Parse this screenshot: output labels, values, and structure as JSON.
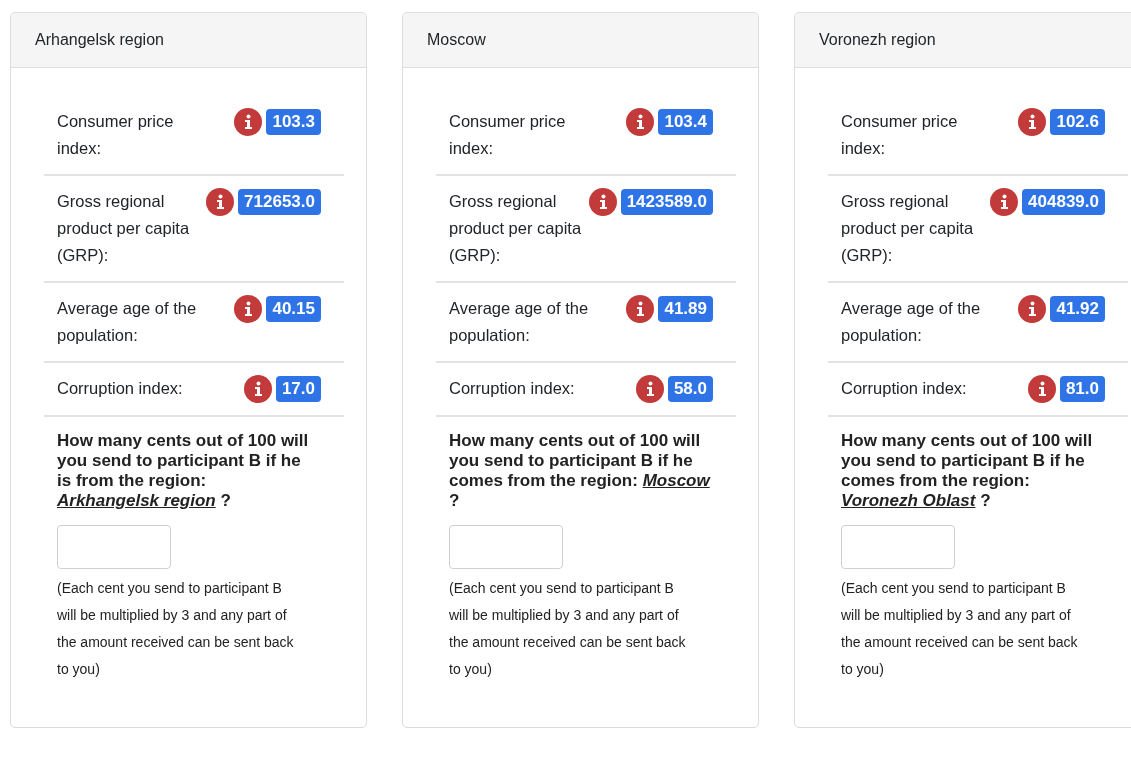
{
  "cards": [
    {
      "title": "Arhangelsk region",
      "indicators": [
        {
          "label": "Consumer price index:",
          "value": "103.3"
        },
        {
          "label": "Gross regional product per capita (GRP):",
          "value": "712653.0"
        },
        {
          "label": "Average age of the population:",
          "value": "40.15"
        },
        {
          "label": "Corruption index:",
          "value": "17.0"
        }
      ],
      "question": "How many cents out of 100 will you send to participant B if he is from the region:",
      "region": "Arkhangelsk region",
      "question_end": "?",
      "note": "(Each cent you send to participant B will be multiplied by 3 and any part of the amount received can be sent back to you)"
    },
    {
      "title": "Moscow",
      "indicators": [
        {
          "label": "Consumer price index:",
          "value": "103.4"
        },
        {
          "label": "Gross regional product per capita (GRP):",
          "value": "1423589.0"
        },
        {
          "label": "Average age of the population:",
          "value": "41.89"
        },
        {
          "label": "Corruption index:",
          "value": "58.0"
        }
      ],
      "question": "How many cents out of 100 will you send to participant B if he comes from the region:",
      "region": "Moscow",
      "question_end": "?",
      "note": "(Each cent you send to participant B will be multiplied by 3 and any part of the amount received can be sent back to you)"
    },
    {
      "title": "Voronezh region",
      "indicators": [
        {
          "label": "Consumer price index:",
          "value": "102.6"
        },
        {
          "label": "Gross regional product per capita (GRP):",
          "value": "404839.0"
        },
        {
          "label": "Average age of the population:",
          "value": "41.92"
        },
        {
          "label": "Corruption index:",
          "value": "81.0"
        }
      ],
      "question": "How many cents out of 100 will you send to participant B if he comes from the region:",
      "region": "Voronezh Oblast",
      "question_end": "?",
      "note": "(Each cent you send to participant B will be multiplied by 3 and any part of the amount received can be sent back to you)"
    }
  ]
}
